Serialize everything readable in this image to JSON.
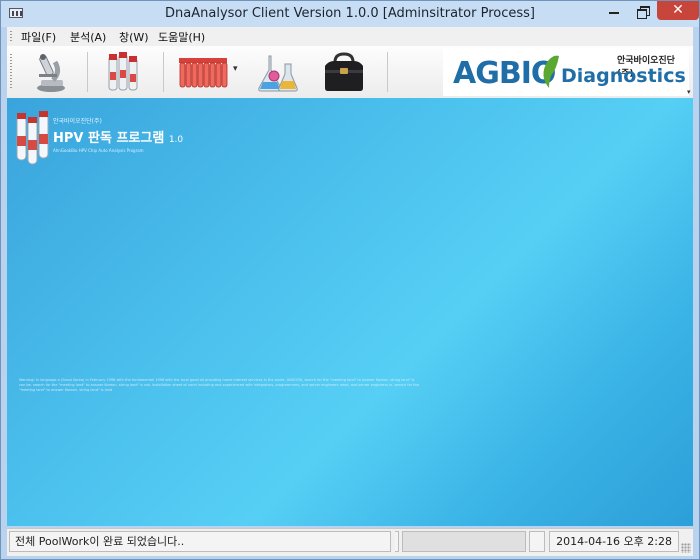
{
  "window": {
    "title": "DnaAnalysor Client Version 1.0.0 [Adminsitrator Process]",
    "close_symbol": "✕"
  },
  "menu": {
    "items": [
      "파일(F)",
      "분석(A)",
      "창(W)",
      "도움말(H)"
    ]
  },
  "toolbar": {
    "buttons": [
      {
        "icon": "microscope-icon"
      },
      {
        "icon": "sample-tubes-icon"
      },
      {
        "icon": "pcr-strip-icon",
        "has_dropdown": true
      },
      {
        "icon": "lab-flasks-icon"
      },
      {
        "icon": "medical-bag-icon"
      }
    ],
    "dropdown_symbol": "▾",
    "logo": {
      "korean": "안국바이오진단(주)",
      "ag_text": "AGBIO",
      "diagnostics_text": "Diagnostics",
      "colors": {
        "brand_blue": "#1f6ea8",
        "brand_green": "#5aa832"
      }
    },
    "overflow_symbol": "▾"
  },
  "banner": {
    "brand_small": "안국바이오진단(주)",
    "title": "HPV 판독 프로그램",
    "version": "1.0",
    "subtitle": "AhnGookBio HPV Chip Auto Analysis Program",
    "copyright": "Warning! In language a (Seoul Korea) in February 1998 with the fundamental 1998 with the local good all providing home interest services in the world. ANGOOK, search for the \"meeting land\" to answer Korean. string land\" is can be. search for the \"meeting land\" to answer Korean. string land\" is not. Installation sheet of vorld including and experienced with integrators, programmers, and server engineers need, and server engineers in. search for the \"meeting land\" to answer Korean. string land\" is land"
  },
  "status": {
    "message": "전체 PoolWork이 완료 되었습니다..",
    "progress": 0,
    "datetime": "2014-04-16 오후 2:28"
  }
}
